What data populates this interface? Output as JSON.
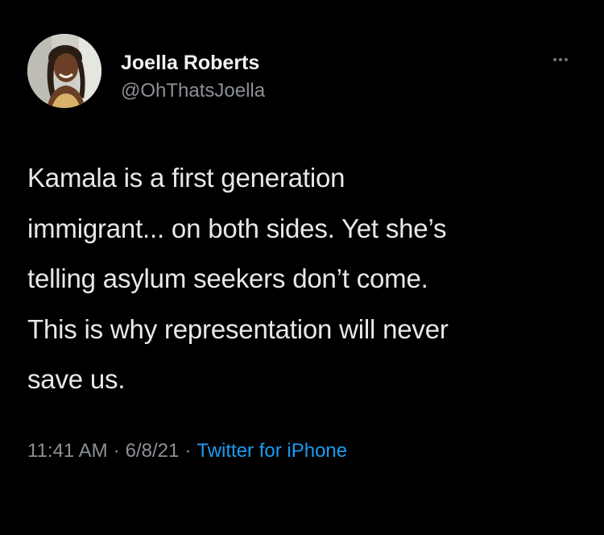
{
  "tweet": {
    "author": {
      "display_name": "Joella Roberts",
      "handle": "@OhThatsJoella",
      "avatar_icon": "profile-photo"
    },
    "more_icon": "more-horizontal-icon",
    "text": "Kamala is a first generation\nimmigrant... on both sides. Yet she’s\ntelling asylum seekers don’t come.\nThis is why representation will never\nsave us.",
    "meta": {
      "time": "11:41 AM",
      "separator": "·",
      "date": "6/8/21",
      "source": "Twitter for iPhone"
    }
  },
  "colors": {
    "background": "#000000",
    "text": "#e8e8e8",
    "secondary": "#8b9096",
    "link": "#1d9bf0"
  }
}
